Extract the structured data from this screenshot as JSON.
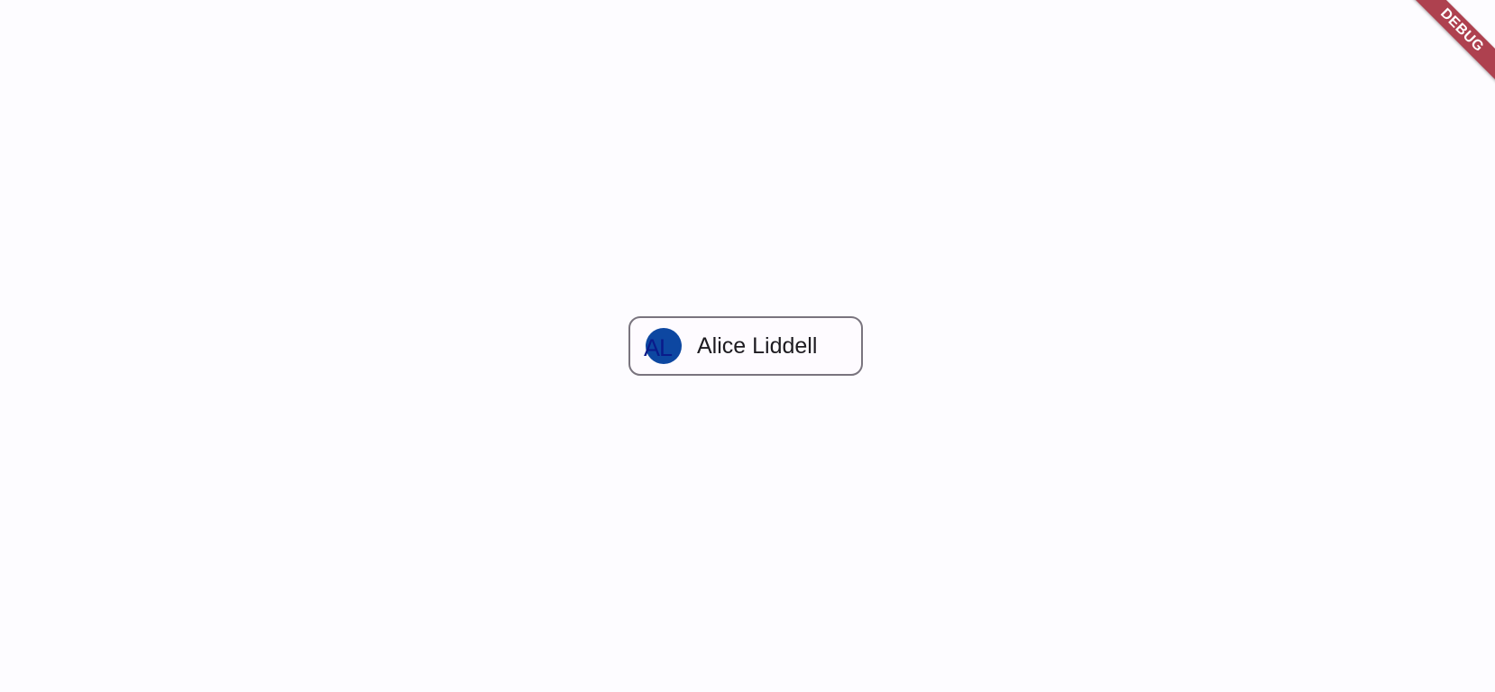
{
  "chip": {
    "avatar_initials": "AL",
    "label": "Alice Liddell"
  },
  "debug_banner": {
    "label": "DEBUG"
  },
  "colors": {
    "background": "#fdfcff",
    "chip_border": "#79747e",
    "avatar_fill": "#0d47a1",
    "avatar_text": "#0a1a8a",
    "label_text": "#1d1b20",
    "debug_banner": "#a02030"
  }
}
